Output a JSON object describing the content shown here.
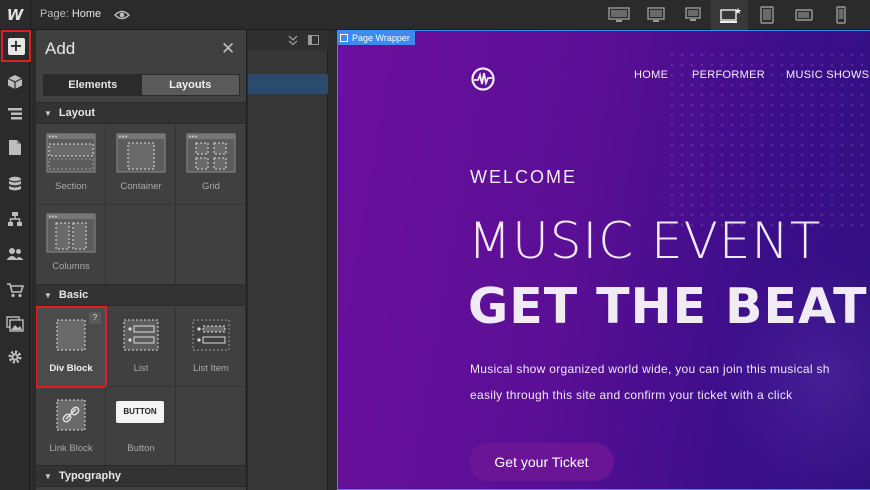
{
  "topbar": {
    "logo": "W",
    "page_prefix": "Page:",
    "page_name": "Home",
    "devices": [
      {
        "icon": "desktop-large-icon",
        "active": false
      },
      {
        "icon": "desktop-medium-icon",
        "active": false
      },
      {
        "icon": "desktop-small-icon",
        "active": false
      },
      {
        "icon": "desktop-base-icon",
        "active": true
      },
      {
        "icon": "tablet-icon",
        "active": false
      },
      {
        "icon": "mobile-landscape-icon",
        "active": false
      },
      {
        "icon": "mobile-portrait-icon",
        "active": false
      }
    ]
  },
  "left_toolbar": [
    "add-icon",
    "symbols-icon",
    "navigator-icon",
    "pages-icon",
    "cms-icon",
    "ecommerce-icon",
    "users-icon",
    "cart-icon",
    "assets-icon",
    "settings-icon"
  ],
  "add_panel": {
    "title": "Add",
    "close_glyph": "✕",
    "tabs": {
      "elements": "Elements",
      "layouts": "Layouts"
    },
    "sections": {
      "layout": "Layout",
      "basic": "Basic",
      "typography": "Typography"
    },
    "layout_items": [
      "Section",
      "Container",
      "Grid",
      "Columns"
    ],
    "basic_items": [
      "Div Block",
      "List",
      "List Item",
      "Link Block",
      "Button"
    ],
    "button_preview": "BUTTON",
    "help_glyph": "?"
  },
  "canvas": {
    "selection_tag": "Page Wrapper",
    "nav": [
      "HOME",
      "PERFORMER",
      "MUSIC SHOWS"
    ],
    "welcome": "WELCOME",
    "headline_1": "MUSIC EVENT",
    "headline_2": "GET THE BEAT",
    "description_1": "Musical show organized world wide, you can join this musical sh",
    "description_2": "easily through this site and confirm your ticket with a click",
    "cta": "Get your Ticket"
  },
  "colors": {
    "accent_blue": "#3d8bf0",
    "highlight_red": "#e02020",
    "hero_purple": "#5a0f95",
    "cta_purple": "#6a1596"
  }
}
